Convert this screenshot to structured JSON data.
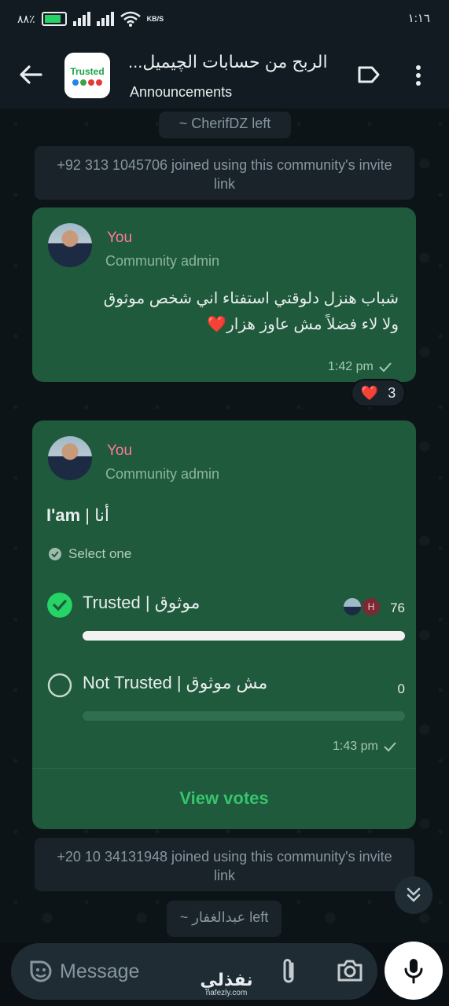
{
  "status_bar": {
    "battery_percent": "٨٨٪",
    "network_speed": "KB/S",
    "time": "١:١٦"
  },
  "header": {
    "group_icon_text": "Trusted",
    "title": "الربح من حسابات الچيميل...",
    "subtitle": "Announcements"
  },
  "system_messages": {
    "left_1": "~ CherifDZ left",
    "joined_1": "+92 313 1045706 joined using this community's invite link",
    "joined_2": "+20 10 34131948 joined using this community's invite link",
    "left_2": "~ عبدالغفار left"
  },
  "message_1": {
    "sender": "You",
    "role": "Community admin",
    "text_line1": "شباب هنزل دلوقتي استفتاء اني  شخص موثوق",
    "text_line2": "ولا لاء فضلاً  مش عاوز هزار❤️",
    "time": "1:42 pm",
    "reaction_emoji": "❤️",
    "reaction_count": "3"
  },
  "poll": {
    "sender": "You",
    "role": "Community admin",
    "question_bold": "I'am",
    "question_rest": " | أنا",
    "select_hint": "Select one",
    "options": [
      {
        "label": "Trusted  | موثوق",
        "count": "76",
        "fraction": 1.0,
        "selected": true,
        "voter_initial": "H"
      },
      {
        "label": "Not Trusted | مش موثوق",
        "count": "0",
        "fraction": 0.0,
        "selected": false
      }
    ],
    "time": "1:43 pm",
    "view_votes": "View votes"
  },
  "composer": {
    "placeholder": "Message"
  },
  "watermark": {
    "arabic": "نفذلي",
    "latin": "nafezly.com"
  },
  "colors": {
    "bubble": "#1e5a3b",
    "accent_green": "#25d366",
    "sender_pink": "#ff7aa0"
  }
}
